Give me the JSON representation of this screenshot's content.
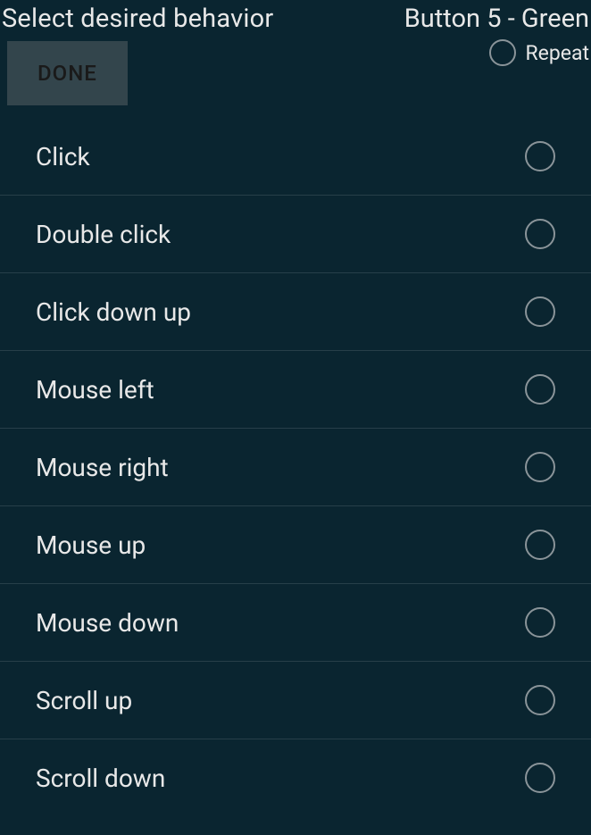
{
  "header": {
    "title": "Select desired behavior",
    "subtitle": "Button 5 - Green",
    "repeat_label": "Repeat",
    "done_label": "DONE"
  },
  "options": [
    {
      "label": "Click"
    },
    {
      "label": "Double click"
    },
    {
      "label": "Click down up"
    },
    {
      "label": "Mouse left"
    },
    {
      "label": "Mouse right"
    },
    {
      "label": "Mouse up"
    },
    {
      "label": "Mouse down"
    },
    {
      "label": "Scroll up"
    },
    {
      "label": "Scroll down"
    }
  ]
}
